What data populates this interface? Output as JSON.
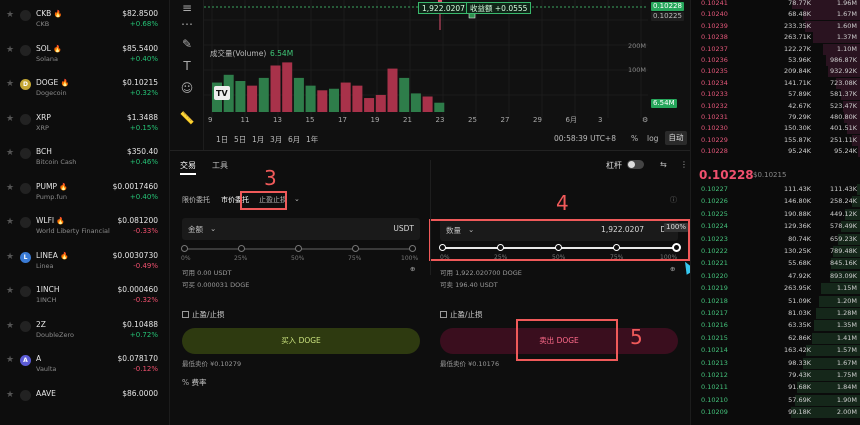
{
  "coins": [
    {
      "sym": "CKB",
      "name": "CKB",
      "price": "$82.8500",
      "chg": "+0.68%",
      "dir": "up",
      "logo": "",
      "logo_color": "#222",
      "fire": true
    },
    {
      "sym": "SOL",
      "name": "Solana",
      "price": "$85.5400",
      "chg": "+0.40%",
      "dir": "up",
      "logo": "",
      "logo_color": "#222",
      "fire": true
    },
    {
      "sym": "DOGE",
      "name": "Dogecoin",
      "price": "$0.10215",
      "chg": "+0.32%",
      "dir": "up",
      "logo": "D",
      "logo_color": "#c3a634",
      "fire": true
    },
    {
      "sym": "XRP",
      "name": "XRP",
      "price": "$1.3488",
      "chg": "+0.15%",
      "dir": "up",
      "logo": "",
      "logo_color": "#222",
      "fire": false
    },
    {
      "sym": "BCH",
      "name": "Bitcoin Cash",
      "price": "$350.40",
      "chg": "+0.46%",
      "dir": "up",
      "logo": "",
      "logo_color": "#222",
      "fire": false
    },
    {
      "sym": "PUMP",
      "name": "Pump.fun",
      "price": "$0.0017460",
      "chg": "+0.40%",
      "dir": "up",
      "logo": "",
      "logo_color": "#222",
      "fire": true
    },
    {
      "sym": "WLFI",
      "name": "World Liberty Financial",
      "price": "$0.081200",
      "chg": "-0.33%",
      "dir": "down",
      "logo": "",
      "logo_color": "#222",
      "fire": true
    },
    {
      "sym": "LINEA",
      "name": "Linea",
      "price": "$0.0030730",
      "chg": "-0.49%",
      "dir": "down",
      "logo": "L",
      "logo_color": "#3a7bd5",
      "fire": true
    },
    {
      "sym": "1INCH",
      "name": "1INCH",
      "price": "$0.000460",
      "chg": "-0.32%",
      "dir": "down",
      "logo": "",
      "logo_color": "#222",
      "fire": false
    },
    {
      "sym": "2Z",
      "name": "DoubleZero",
      "price": "$0.10488",
      "chg": "+0.72%",
      "dir": "up",
      "logo": "",
      "logo_color": "#222",
      "fire": false
    },
    {
      "sym": "A",
      "name": "Vaulta",
      "price": "$0.078170",
      "chg": "-0.12%",
      "dir": "down",
      "logo": "A",
      "logo_color": "#5b5bd6",
      "fire": false
    },
    {
      "sym": "AAVE",
      "name": "",
      "price": "$86.0000",
      "chg": "",
      "dir": "up",
      "logo": "",
      "logo_color": "#222",
      "fire": false
    }
  ],
  "chart": {
    "price_pill": "1,922.0207",
    "pnl_pill": "收益额 +0.0555",
    "tag_a": "0.10228",
    "tag_b": "0.10225",
    "tag_vol": "6.54M",
    "vol_label": "成交量(Volume)",
    "vol_value": "6.54M",
    "axis_200m": "200M",
    "axis_100m": "100M",
    "logo_text": "TV",
    "x_ticks": [
      "9",
      "11",
      "13",
      "15",
      "17",
      "19",
      "21",
      "23",
      "25",
      "27",
      "29",
      "6月",
      "3"
    ],
    "ranges": [
      "1日",
      "5日",
      "1月",
      "3月",
      "6月",
      "1年"
    ],
    "time": "00:58:39 UTC+8",
    "pct": "%",
    "log": "log",
    "auto": "自动"
  },
  "chart_data": {
    "type": "bar",
    "title": "",
    "series": [
      {
        "name": "成交量(Volume)",
        "values": [
          0,
          0,
          0,
          0,
          0,
          0,
          0,
          0,
          0,
          0,
          0,
          0,
          0,
          0,
          0,
          0,
          0,
          0,
          0,
          0,
          0,
          0,
          0,
          0
        ]
      }
    ],
    "candles": [
      {
        "day": 9,
        "vol": 95,
        "dir": "up"
      },
      {
        "day": 10,
        "vol": 120,
        "dir": "up"
      },
      {
        "day": 11,
        "vol": 100,
        "dir": "up"
      },
      {
        "day": 12,
        "vol": 85,
        "dir": "down"
      },
      {
        "day": 13,
        "vol": 110,
        "dir": "up"
      },
      {
        "day": 14,
        "vol": 150,
        "dir": "down"
      },
      {
        "day": 15,
        "vol": 160,
        "dir": "down"
      },
      {
        "day": 16,
        "vol": 110,
        "dir": "up"
      },
      {
        "day": 17,
        "vol": 85,
        "dir": "up"
      },
      {
        "day": 18,
        "vol": 70,
        "dir": "down"
      },
      {
        "day": 19,
        "vol": 75,
        "dir": "up"
      },
      {
        "day": 20,
        "vol": 95,
        "dir": "down"
      },
      {
        "day": 21,
        "vol": 85,
        "dir": "down"
      },
      {
        "day": 22,
        "vol": 45,
        "dir": "down"
      },
      {
        "day": 23,
        "vol": 55,
        "dir": "down"
      },
      {
        "day": 24,
        "vol": 140,
        "dir": "down"
      },
      {
        "day": 25,
        "vol": 110,
        "dir": "up"
      },
      {
        "day": 26,
        "vol": 60,
        "dir": "up"
      },
      {
        "day": 27,
        "vol": 50,
        "dir": "down"
      },
      {
        "day": 28,
        "vol": 30,
        "dir": "up"
      }
    ],
    "xlabel": "",
    "ylabel": "",
    "ylim": [
      0,
      200
    ]
  },
  "trade": {
    "tab_trade": "交易",
    "tab_tools": "工具",
    "leverage": "杠杆",
    "sub_limit": "限价委托",
    "sub_market": "市价委托",
    "sub_stop": "止盈止损",
    "buy_label": "金额",
    "buy_unit": "USDT",
    "sell_label": "数量",
    "sell_value": "1,922.0207",
    "sell_unit": "DO",
    "pct_tip": "100%",
    "slider_lbls": [
      "0%",
      "25%",
      "50%",
      "75%",
      "100%"
    ],
    "buy_avail": "可用 0.00 USDT",
    "buy_max": "可买 0.000031 DOGE",
    "sell_avail": "可用 1,922.020700 DOGE",
    "sell_max": "可卖 196.40 USDT",
    "buy_tpsl": "止盈/止损",
    "sell_tpsl": "止盈/止损",
    "buy_btn": "买入 DOGE",
    "sell_btn": "卖出 DOGE",
    "buy_price": "最低卖价 ¥0.10279",
    "sell_price": "最低卖价 ¥0.10176",
    "fee": "费率",
    "annot3": "3",
    "annot4": "4",
    "annot5": "5"
  },
  "orderbook": {
    "asks": [
      [
        "0.10241",
        "78.77K",
        "1.96M"
      ],
      [
        "0.10240",
        "68.48K",
        "1.67M"
      ],
      [
        "0.10239",
        "233.35K",
        "1.60M"
      ],
      [
        "0.10238",
        "263.71K",
        "1.37M"
      ],
      [
        "0.10237",
        "122.27K",
        "1.10M"
      ],
      [
        "0.10236",
        "53.96K",
        "986.87K"
      ],
      [
        "0.10235",
        "209.84K",
        "932.92K"
      ],
      [
        "0.10234",
        "141.71K",
        "723.08K"
      ],
      [
        "0.10233",
        "57.89K",
        "581.37K"
      ],
      [
        "0.10232",
        "42.67K",
        "523.47K"
      ],
      [
        "0.10231",
        "79.29K",
        "480.80K"
      ],
      [
        "0.10230",
        "150.30K",
        "401.51K"
      ],
      [
        "0.10229",
        "155.87K",
        "251.11K"
      ],
      [
        "0.10228",
        "95.24K",
        "95.24K"
      ]
    ],
    "mid": "0.10228",
    "mid_sub": "$0.10215",
    "bids": [
      [
        "0.10227",
        "111.43K",
        "111.43K"
      ],
      [
        "0.10226",
        "146.80K",
        "258.24K"
      ],
      [
        "0.10225",
        "190.88K",
        "449.12K"
      ],
      [
        "0.10224",
        "129.36K",
        "578.49K"
      ],
      [
        "0.10223",
        "80.74K",
        "659.23K"
      ],
      [
        "0.10222",
        "130.25K",
        "789.48K"
      ],
      [
        "0.10221",
        "55.68K",
        "845.16K"
      ],
      [
        "0.10220",
        "47.92K",
        "893.09K"
      ],
      [
        "0.10219",
        "263.95K",
        "1.15M"
      ],
      [
        "0.10218",
        "51.09K",
        "1.20M"
      ],
      [
        "0.10217",
        "81.03K",
        "1.28M"
      ],
      [
        "0.10216",
        "63.35K",
        "1.35M"
      ],
      [
        "0.10215",
        "62.86K",
        "1.41M"
      ],
      [
        "0.10214",
        "163.42K",
        "1.57M"
      ],
      [
        "0.10213",
        "98.33K",
        "1.67M"
      ],
      [
        "0.10212",
        "79.43K",
        "1.75M"
      ],
      [
        "0.10211",
        "91.68K",
        "1.84M"
      ],
      [
        "0.10210",
        "57.69K",
        "1.90M"
      ],
      [
        "0.10209",
        "99.18K",
        "2.00M"
      ]
    ]
  }
}
